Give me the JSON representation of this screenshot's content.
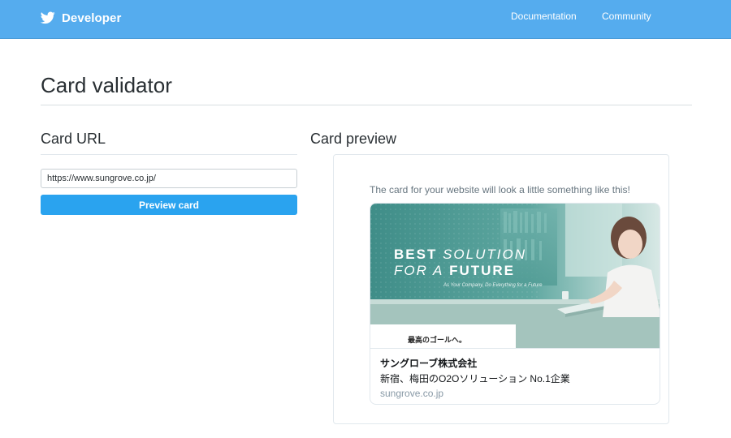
{
  "nav": {
    "brand": "Developer",
    "links": [
      "Documentation",
      "Community"
    ]
  },
  "page": {
    "title": "Card validator"
  },
  "left": {
    "heading": "Card URL",
    "url_value": "https://www.sungrove.co.jp/",
    "button_label": "Preview card"
  },
  "right": {
    "heading": "Card preview",
    "caption": "The card for your website will look a little something like this!"
  },
  "card": {
    "image": {
      "headline_word1": "BEST",
      "headline_word2": "SOLUTION",
      "headline_word3": "FOR A",
      "headline_word4": "FUTURE",
      "subline": "As Your Company, Do Everything for a Future",
      "tagline": "最高のゴールへ。"
    },
    "title": "サングローブ株式会社",
    "description": "新宿、梅田のO2Oソリューション No.1企業",
    "domain": "sungrove.co.jp"
  },
  "colors": {
    "topbar": "#55acee",
    "button": "#2aa3ef",
    "card_image_teal": "#4f9a93"
  }
}
